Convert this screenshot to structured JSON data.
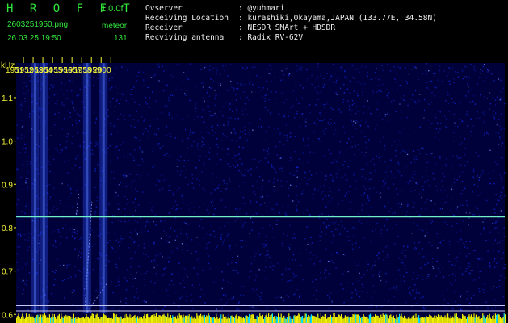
{
  "header": {
    "app_name": "H R O F F T",
    "version": "1.0.0f",
    "filename": "2603251950.png",
    "datetime": "26.03.25 19:50",
    "mode": "meteor",
    "count": "131",
    "info_labels": [
      "Ovserver",
      "Receiving Location",
      "Receiver",
      "Recviving antenna"
    ],
    "info_values": [
      ": @yuhmari",
      ": kurashiki,Okayama,JAPAN (133.77E, 34.58N)",
      ": NESDR SMArt + HDSDR",
      ": Radix RV-62V"
    ]
  },
  "chart_data": {
    "type": "heatmap",
    "ylabel": "kHz",
    "y_ticks": [
      "1.1",
      "1.0",
      "0.9",
      "0.8",
      "0.7",
      "0.6"
    ],
    "y_tick_values": [
      1.1,
      1.0,
      0.9,
      0.8,
      0.7,
      0.6
    ],
    "ylim": [
      0.58,
      1.18
    ],
    "x_ticks": [
      "1951",
      "1952",
      "1953",
      "1954",
      "1955",
      "1956",
      "1957",
      "1958",
      "1959",
      "2000"
    ],
    "xlim": [
      1950,
      2000.3
    ],
    "carrier_line_khz": 0.825,
    "reference_lines_khz": [
      0.62,
      0.608
    ],
    "vertical_bands_time": [
      1951.95,
      1952.85,
      1957.3,
      1959.0
    ],
    "meteor_streaks": [
      {
        "x": [
          1957.15,
          1959.3
        ],
        "y": [
          0.6,
          0.67
        ]
      },
      {
        "x": [
          1957.1,
          1957.8
        ],
        "y": [
          0.62,
          0.86
        ]
      },
      {
        "x": [
          1956.2,
          1956.45
        ],
        "y": [
          0.83,
          0.88
        ]
      }
    ],
    "colors": {
      "background": "#00003a",
      "noise": "#1228d8",
      "carrier": "#6ff0c8",
      "reference": "#c8c8f0",
      "signal_bar": "#f0f000"
    }
  }
}
